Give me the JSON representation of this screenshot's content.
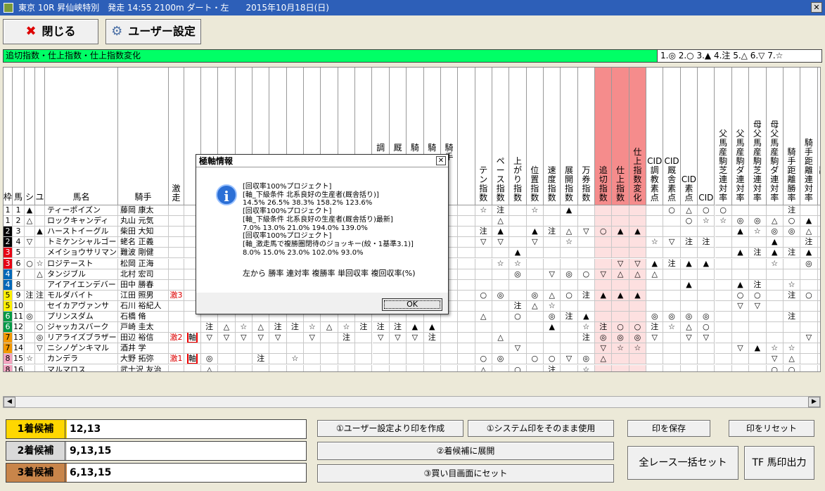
{
  "window": {
    "title": "東京 10R 昇仙峡特別　発走 14:55 2100m ダート・左　　2015年10月18日(日)",
    "close": "✕"
  },
  "toolbar": {
    "close_label": "閉じる",
    "settings_label": "ユーザー設定"
  },
  "banner": {
    "title": "追切指数・仕上指数・仕上指数変化",
    "legend": "1.◎ 2.○ 3.▲ 4.注 5.△ 6.▽ 7.☆"
  },
  "headers": {
    "waku": "枠",
    "uma": "馬",
    "shi": "シ",
    "yu": "ユ",
    "name": "馬名",
    "jockey": "騎手",
    "gekisou": "激走",
    "dcols": [
      "",
      "",
      "",
      "",
      "",
      "",
      "",
      "",
      "",
      "",
      "調",
      "厩",
      "騎",
      "騎",
      "騎手",
      "",
      "",
      "ペース指数",
      "上がり指数",
      "位置指数",
      "速度指数",
      "展開指数",
      "万券指数",
      "追切指数",
      "仕上指数",
      "仕上指数変化",
      "CID調教素点",
      "CID厩舎素点",
      "CID素点",
      "CID",
      "父馬産駒芝連対率",
      "父馬産駒ダ連対率",
      "母父馬産駒芝連対率",
      "母父馬産駒ダ連対率",
      "騎手距離勝率",
      "騎手距離連対率",
      "騎手距離3着内率",
      "騎手トラック距離勝率"
    ],
    "tenkey": "テン指数"
  },
  "pink_cols": [
    23,
    24,
    25
  ],
  "rows": [
    {
      "waku": "1",
      "uma": "1",
      "shi": "▲",
      "yu": "",
      "name": "ティーポイズン",
      "jockey": "藤岡 康太",
      "gek": "",
      "jiku": "",
      "marks": [
        "",
        "",
        "",
        "",
        "",
        "",
        "",
        "",
        "",
        "",
        "",
        "",
        "",
        "",
        "",
        "",
        "☆",
        "注",
        "",
        "☆",
        "",
        "▲",
        "",
        "",
        "",
        "",
        "",
        "○",
        "△",
        "○",
        "○",
        "",
        "",
        "",
        "注",
        "",
        "",
        "",
        ""
      ]
    },
    {
      "waku": "1",
      "uma": "2",
      "shi": "△",
      "yu": "",
      "name": "ロックキャンディ",
      "jockey": "丸山 元気",
      "gek": "",
      "jiku": "",
      "marks": [
        "",
        "",
        "",
        "",
        "",
        "",
        "",
        "",
        "",
        "",
        "",
        "",
        "",
        "",
        "",
        "",
        "",
        "△",
        "",
        "",
        "",
        "",
        "",
        "",
        "",
        "",
        "",
        "",
        "○",
        "☆",
        "☆",
        "◎",
        "◎",
        "△",
        "○",
        "▲",
        "▲",
        "注",
        "注"
      ]
    },
    {
      "waku": "2",
      "uma": "3",
      "shi": "",
      "yu": "▲",
      "name": "ハーストイーグル",
      "jockey": "柴田 大知",
      "gek": "",
      "jiku": "",
      "marks": [
        "",
        "",
        "",
        "",
        "",
        "",
        "",
        "",
        "",
        "",
        "",
        "",
        "",
        "",
        "",
        "",
        "注",
        "▲",
        "",
        "▲",
        "注",
        "△",
        "▽",
        "○",
        "▲",
        "▲",
        "",
        "",
        "",
        "",
        "",
        "▲",
        "☆",
        "◎",
        "◎",
        "△",
        "△",
        "△",
        ""
      ]
    },
    {
      "waku": "2",
      "uma": "4",
      "shi": "▽",
      "yu": "",
      "name": "トミケンシャルゴー",
      "jockey": "蛯名 正義",
      "gek": "",
      "jiku": "",
      "marks": [
        "",
        "",
        "",
        "",
        "",
        "",
        "",
        "",
        "",
        "",
        "",
        "",
        "",
        "",
        "",
        "",
        "▽",
        "▽",
        "",
        "▽",
        "",
        "☆",
        "",
        "",
        "",
        "",
        "☆",
        "▽",
        "注",
        "注",
        "",
        "",
        "",
        "▲",
        "",
        "注",
        "△",
        "▽",
        "▲"
      ]
    },
    {
      "waku": "3",
      "uma": "5",
      "shi": "",
      "yu": "",
      "name": "メイショウサリマン",
      "jockey": "難波 剛健",
      "gek": "",
      "jiku": "",
      "marks": [
        "",
        "",
        "",
        "",
        "",
        "",
        "",
        "",
        "",
        "",
        "",
        "",
        "",
        "",
        "",
        "",
        "",
        "",
        "▲",
        "",
        "",
        "",
        "",
        "",
        "",
        "",
        "",
        "",
        "",
        "",
        "",
        "▲",
        "注",
        "▲",
        "注",
        "▲",
        "☆",
        "注",
        "▲"
      ]
    },
    {
      "waku": "3",
      "uma": "6",
      "shi": "○",
      "yu": "☆",
      "name": "ロジテースト",
      "jockey": "松岡 正海",
      "gek": "",
      "jiku": "",
      "marks": [
        "",
        "",
        "",
        "",
        "",
        "",
        "",
        "",
        "",
        "",
        "",
        "",
        "",
        "",
        "",
        "",
        "",
        "☆",
        "☆",
        "",
        "",
        "",
        "",
        "",
        "▽",
        "▽",
        "▲",
        "注",
        "▲",
        "▲",
        "",
        "",
        "",
        "☆",
        "",
        "◎",
        "○",
        "▲",
        "○"
      ]
    },
    {
      "waku": "4",
      "uma": "7",
      "shi": "",
      "yu": "△",
      "name": "タンジブル",
      "jockey": "北村 宏司",
      "gek": "",
      "jiku": "",
      "marks": [
        "",
        "",
        "",
        "",
        "",
        "",
        "",
        "",
        "",
        "",
        "",
        "",
        "",
        "",
        "",
        "",
        "",
        "",
        "◎",
        "",
        "▽",
        "◎",
        "○",
        "▽",
        "△",
        "△",
        "△",
        "",
        "",
        "",
        "",
        "",
        "",
        "",
        "",
        "",
        "",
        "",
        ""
      ]
    },
    {
      "waku": "4",
      "uma": "8",
      "shi": "",
      "yu": "",
      "name": "アイアイエンデバー",
      "jockey": "田中 勝春",
      "gek": "",
      "jiku": "",
      "marks": [
        "",
        "",
        "",
        "",
        "",
        "",
        "",
        "",
        "",
        "",
        "",
        "",
        "",
        "",
        "",
        "",
        "",
        "",
        "",
        "",
        "",
        "",
        "",
        "",
        "",
        "",
        "",
        "",
        "▲",
        "",
        "",
        "▲",
        "注",
        "",
        "☆",
        "",
        "",
        "",
        ""
      ]
    },
    {
      "waku": "5",
      "uma": "9",
      "shi": "注",
      "yu": "注",
      "name": "モルダバイト",
      "jockey": "江田 照男",
      "gek": "激3",
      "jiku": "",
      "marks": [
        "",
        "",
        "",
        "",
        "",
        "",
        "",
        "",
        "",
        "",
        "",
        "",
        "",
        "",
        "",
        "",
        "○",
        "◎",
        "",
        "◎",
        "△",
        "○",
        "注",
        "▲",
        "▲",
        "▲",
        "",
        "",
        "",
        "",
        "",
        "○",
        "○",
        "",
        "注",
        "○",
        "◎",
        "○",
        ""
      ]
    },
    {
      "waku": "5",
      "uma": "10",
      "shi": "",
      "yu": "",
      "name": "セイカアヴァンサ",
      "jockey": "石川 裕紀人",
      "gek": "",
      "jiku": "",
      "marks": [
        "",
        "",
        "",
        "",
        "",
        "",
        "",
        "",
        "",
        "",
        "",
        "",
        "",
        "",
        "",
        "",
        "",
        "",
        "注",
        "△",
        "☆",
        "",
        "",
        "",
        "",
        "",
        "",
        "",
        "",
        "",
        "",
        "▽",
        "▽",
        "",
        "",
        "",
        "",
        "",
        ""
      ]
    },
    {
      "waku": "6",
      "uma": "11",
      "shi": "◎",
      "yu": "",
      "name": "プリンスダム",
      "jockey": "石橋 脩",
      "gek": "",
      "jiku": "",
      "marks": [
        "",
        "",
        "",
        "",
        "",
        "",
        "",
        "",
        "",
        "",
        "",
        "",
        "",
        "",
        "",
        "",
        "△",
        "",
        "○",
        "",
        "◎",
        "注",
        "▲",
        "",
        "",
        "",
        "◎",
        "◎",
        "◎",
        "◎",
        "",
        "",
        "",
        "",
        "注",
        "",
        "☆",
        "◎",
        ""
      ]
    },
    {
      "waku": "6",
      "uma": "12",
      "shi": "",
      "yu": "○",
      "name": "ジャッカスバーク",
      "jockey": "戸崎 圭太",
      "gek": "",
      "jiku": "",
      "marks": [
        "注",
        "△",
        "☆",
        "△",
        "注",
        "注",
        "☆",
        "△",
        "☆",
        "注",
        "注",
        "注",
        "▲",
        "▲",
        "",
        "",
        "",
        "",
        "",
        "",
        "▲",
        "",
        "☆",
        "注",
        "○",
        "○",
        "注",
        "☆",
        "△",
        "○",
        "",
        "",
        "",
        "",
        "",
        "",
        "",
        "",
        "注"
      ]
    },
    {
      "waku": "7",
      "uma": "13",
      "shi": "",
      "yu": "◎",
      "name": "リアライズブラザー",
      "jockey": "田辺 裕信",
      "gek": "激2",
      "jiku": "軸",
      "marks": [
        "▽",
        "▽",
        "▽",
        "▽",
        "▽",
        "",
        "▽",
        "",
        "注",
        "",
        "▽",
        "▽",
        "▽",
        "注",
        "",
        "",
        "",
        "△",
        "",
        "",
        "",
        "",
        "注",
        "◎",
        "◎",
        "◎",
        "▽",
        "",
        "▽",
        "▽",
        "",
        "",
        "",
        "",
        "",
        "▽",
        "",
        "",
        "○"
      ]
    },
    {
      "waku": "7",
      "uma": "14",
      "shi": "",
      "yu": "▽",
      "name": "ニシノゲンキマル",
      "jockey": "酒井 学",
      "gek": "",
      "jiku": "",
      "marks": [
        "",
        "",
        "",
        "",
        "",
        "",
        "",
        "",
        "",
        "",
        "",
        "",
        "",
        "",
        "",
        "",
        "",
        "",
        "▽",
        "",
        "",
        "",
        "",
        "▽",
        "☆",
        "☆",
        "",
        "",
        "",
        "",
        "",
        "▽",
        "▲",
        "☆",
        "☆",
        "",
        "",
        "",
        ""
      ]
    },
    {
      "waku": "8",
      "uma": "15",
      "shi": "☆",
      "yu": "",
      "name": "カンデラ",
      "jockey": "大野 拓弥",
      "gek": "激1",
      "jiku": "軸",
      "marks": [
        "◎",
        "",
        "",
        "注",
        "",
        "☆",
        "",
        "",
        "",
        "",
        "",
        "",
        "",
        "",
        "",
        "",
        "○",
        "◎",
        "",
        "○",
        "○",
        "▽",
        "◎",
        "△",
        "",
        "",
        "",
        "",
        "",
        "",
        "",
        "",
        "",
        "▽",
        "△",
        "",
        "",
        "",
        ""
      ]
    },
    {
      "waku": "8",
      "uma": "16",
      "shi": "",
      "yu": "",
      "name": "マルマロス",
      "jockey": "武士沢 友治",
      "gek": "",
      "jiku": "",
      "marks": [
        "△",
        "",
        "",
        "",
        "",
        "",
        "",
        "",
        "",
        "",
        "",
        "",
        "",
        "",
        "",
        "",
        "△",
        "",
        "○",
        "",
        "注",
        "",
        "☆",
        "",
        "",
        "",
        "",
        "",
        "",
        "",
        "",
        "",
        "",
        "○",
        "○",
        "",
        "",
        "",
        "◎"
      ]
    }
  ],
  "waku_colors": {
    "1": "#ffffff",
    "2": "#000000",
    "3": "#e60012",
    "4": "#0068b7",
    "5": "#fff000",
    "6": "#009944",
    "7": "#f39800",
    "8": "#f4a4c0"
  },
  "dialog": {
    "title": "極軸情報",
    "close": "✕",
    "lines": [
      "[回収率100%プロジェクト]",
      "[軸_下級条件 北系良好の生産者(厩舎括り)]",
      "  14.5% 26.5% 38.3% 158.2% 123.6%",
      "[回収率100%プロジェクト]",
      "[軸_下級条件 北系良好の生産者(厩舎括り)最新]",
      "  7.0% 13.0% 21.0% 194.0% 139.0%",
      "[回収率100%プロジェクト]",
      "[軸_激走馬で複勝圏閉待のジョッキー(絞・1基準3.1)]",
      "  8.0% 15.0% 23.0% 102.0% 93.0%",
      "",
      "左から 勝率 連対率 複勝率 単回収率 複回収率(%)"
    ],
    "ok": "OK"
  },
  "candidates": [
    {
      "label": "1着候補",
      "value": "12,13",
      "color": "#ffd700"
    },
    {
      "label": "2着候補",
      "value": "9,13,15",
      "color": "#d9d9d9"
    },
    {
      "label": "3着候補",
      "value": "6,13,15",
      "color": "#c8854a"
    }
  ],
  "actions": {
    "user_marks": "①ユーザー設定より印を作成",
    "system_marks": "①システム印をそのまま使用",
    "save_marks": "印を保存",
    "reset_marks": "印をリセット",
    "expand2": "②着候補に展開",
    "set3": "③買い目画面にセット",
    "all_race": "全レース一括セット",
    "tf": "TF 馬印出力"
  },
  "scroll": {
    "left": "◀",
    "right": "▶"
  }
}
